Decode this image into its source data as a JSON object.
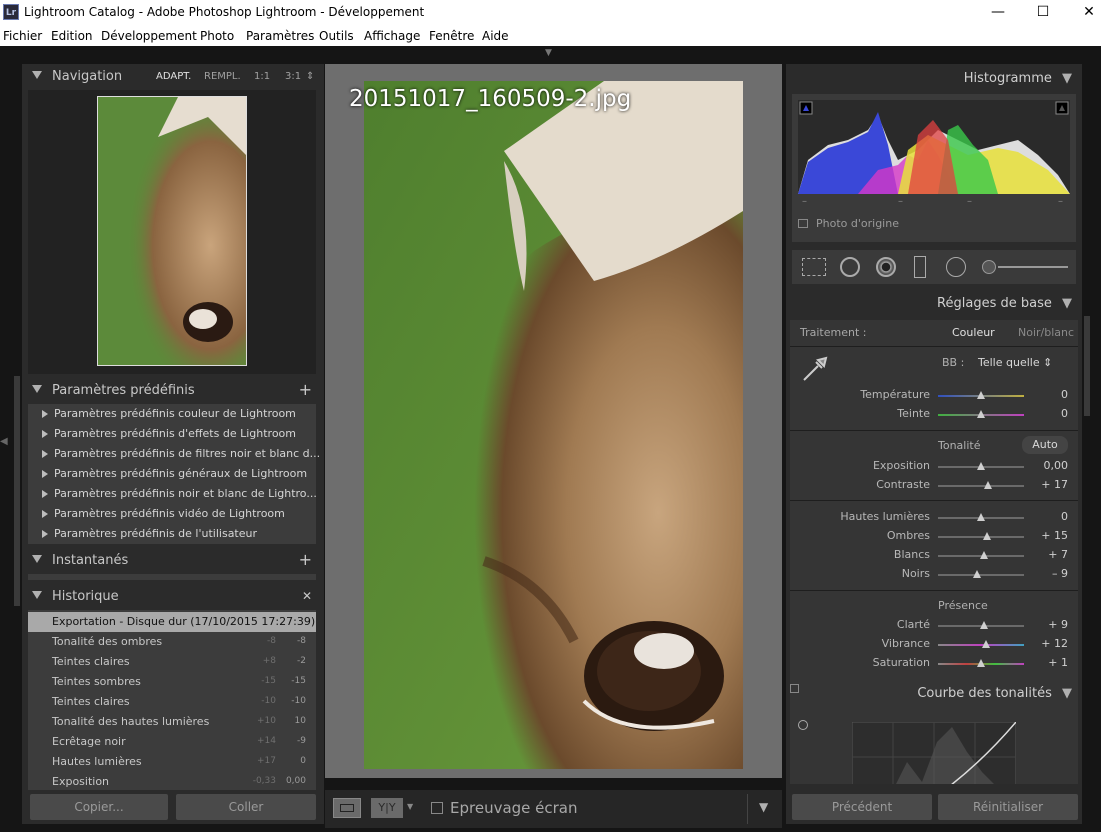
{
  "window": {
    "title": "Lightroom Catalog - Adobe Photoshop Lightroom - Développement",
    "app_icon": "Lr",
    "minimize": "—",
    "maximize": "☐",
    "close": "✕"
  },
  "menu": [
    "Fichier",
    "Edition",
    "Développement",
    "Photo",
    "Paramètres",
    "Outils",
    "Affichage",
    "Fenêtre",
    "Aide"
  ],
  "navigation": {
    "title": "Navigation",
    "zoom_options": [
      "ADAPT.",
      "REMPL.",
      "1:1",
      "3:1"
    ],
    "zoom_arrow": "⇕"
  },
  "presets": {
    "title": "Paramètres prédéfinis",
    "add": "+",
    "items": [
      "Paramètres prédéfinis couleur de Lightroom",
      "Paramètres prédéfinis d'effets de Lightroom",
      "Paramètres prédéfinis de filtres noir et blanc d...",
      "Paramètres prédéfinis généraux de Lightroom",
      "Paramètres prédéfinis noir et blanc de Lightro...",
      "Paramètres prédéfinis vidéo de Lightroom",
      "Paramètres prédéfinis de l'utilisateur"
    ]
  },
  "snapshots": {
    "title": "Instantanés",
    "add": "+"
  },
  "history": {
    "title": "Historique",
    "clear": "✕",
    "items": [
      {
        "name": "Exportation - Disque dur (17/10/2015 17:27:39)",
        "a": "",
        "b": ""
      },
      {
        "name": "Tonalité des ombres",
        "a": "-8",
        "b": "-8"
      },
      {
        "name": "Teintes claires",
        "a": "+8",
        "b": "-2"
      },
      {
        "name": "Teintes sombres",
        "a": "-15",
        "b": "-15"
      },
      {
        "name": "Teintes claires",
        "a": "-10",
        "b": "-10"
      },
      {
        "name": "Tonalité des hautes lumières",
        "a": "+10",
        "b": "10"
      },
      {
        "name": "Ecrêtage noir",
        "a": "+14",
        "b": "-9"
      },
      {
        "name": "Hautes lumières",
        "a": "+17",
        "b": "0"
      },
      {
        "name": "Exposition",
        "a": "-0,33",
        "b": "0,00"
      }
    ]
  },
  "left_buttons": {
    "copy": "Copier...",
    "paste": "Coller"
  },
  "photo": {
    "filename": "20151017_160509-2.jpg"
  },
  "toolbar": {
    "yy": "Y|Y",
    "soft_proof": "Epreuvage écran",
    "menu_arrow": "▼"
  },
  "histogram": {
    "title": "Histogramme",
    "original_photo": "Photo d'origine",
    "readouts": [
      "–",
      "–",
      "–",
      "–"
    ]
  },
  "basic": {
    "title": "Réglages de base",
    "treatment_label": "Traitement :",
    "color": "Couleur",
    "bw": "Noir/blanc",
    "wb_label": "BB :",
    "wb_value": "Telle quelle ⇕",
    "tone_label": "Tonalité",
    "auto": "Auto",
    "presence_label": "Présence",
    "sliders": [
      {
        "label": "Température",
        "value": "0",
        "pos": 0.5
      },
      {
        "label": "Teinte",
        "value": "0",
        "pos": 0.5
      },
      {
        "label": "Exposition",
        "value": "0,00",
        "pos": 0.5
      },
      {
        "label": "Contraste",
        "value": "+ 17",
        "pos": 0.58
      },
      {
        "label": "Hautes lumières",
        "value": "0",
        "pos": 0.5
      },
      {
        "label": "Ombres",
        "value": "+ 15",
        "pos": 0.57
      },
      {
        "label": "Blancs",
        "value": "+ 7",
        "pos": 0.54
      },
      {
        "label": "Noirs",
        "value": "– 9",
        "pos": 0.45
      },
      {
        "label": "Clarté",
        "value": "+ 9",
        "pos": 0.54
      },
      {
        "label": "Vibrance",
        "value": "+ 12",
        "pos": 0.56
      },
      {
        "label": "Saturation",
        "value": "+ 1",
        "pos": 0.5
      }
    ]
  },
  "tone_curve": {
    "title": "Courbe des tonalités"
  },
  "right_buttons": {
    "previous": "Précédent",
    "reset": "Réinitialiser"
  },
  "colors": {
    "panel": "#2b2b2b",
    "accent_text": "#d0d0d0",
    "selected_row": "#a9a9a9"
  }
}
